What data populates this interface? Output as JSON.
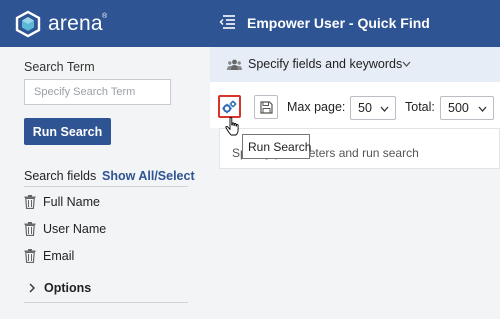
{
  "brand": {
    "name": "arena",
    "reg": "®"
  },
  "sidebar": {
    "search_term_label": "Search Term",
    "search_placeholder": "Specify Search Term",
    "search_value": "",
    "run_button": "Run Search",
    "search_fields_label": "Search fields",
    "show_all_link": "Show All/Select",
    "fields": [
      {
        "label": "Full Name",
        "icon": "trash-icon"
      },
      {
        "label": "User Name",
        "icon": "trash-icon"
      },
      {
        "label": "Email",
        "icon": "trash-icon"
      }
    ],
    "options_label": "Options"
  },
  "header": {
    "title": "Empower User - Quick Find"
  },
  "spec_bar": {
    "label": "Specify fields and keywords"
  },
  "toolbar": {
    "run_tooltip": "Run Search",
    "max_page_label": "Max page:",
    "max_page_value": "50",
    "total_label": "Total:",
    "total_value": "500"
  },
  "content": {
    "message": "Specify parameters and run search"
  },
  "colors": {
    "brand_blue": "#2f5493",
    "accent_red": "#d9342b",
    "spec_bar_bg": "#e6edf7",
    "logo_teal": "#5cb8d6"
  }
}
